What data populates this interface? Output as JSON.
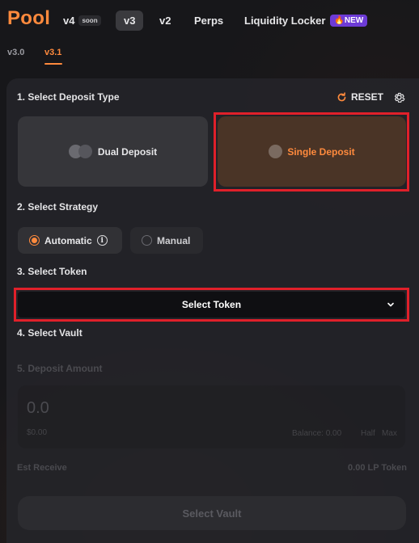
{
  "brand": {
    "logo": "Pool",
    "accent": "#ff8a3d"
  },
  "nav": {
    "tabs": [
      {
        "label": "v4",
        "badge": "soon"
      },
      {
        "label": "v3",
        "active": true
      },
      {
        "label": "v2"
      },
      {
        "label": "Perps"
      },
      {
        "label": "Liquidity Locker",
        "badge": "🔥NEW"
      }
    ],
    "subtabs": [
      {
        "label": "v3.0"
      },
      {
        "label": "v3.1",
        "active": true
      }
    ]
  },
  "form": {
    "step1": {
      "label": "1. Select Deposit Type",
      "reset_label": "RESET",
      "options": [
        {
          "label": "Dual Deposit"
        },
        {
          "label": "Single Deposit",
          "selected": true
        }
      ]
    },
    "step2": {
      "label": "2. Select Strategy",
      "options": [
        {
          "label": "Automatic",
          "selected": true
        },
        {
          "label": "Manual"
        }
      ]
    },
    "step3": {
      "label": "3. Select Token",
      "select_label": "Select Token"
    },
    "step4": {
      "label": "4. Select Vault"
    },
    "step5": {
      "label": "5. Deposit Amount",
      "amount": "0.0",
      "usd": "$0.00",
      "balance": "Balance: 0.00",
      "half_label": "Half",
      "max_label": "Max"
    },
    "est_receive": {
      "label": "Est Receive",
      "value": "0.00 LP Token"
    },
    "submit_label": "Select Vault"
  },
  "icons": {
    "reset": "refresh-icon",
    "settings": "gear-icon",
    "info": "info-icon",
    "chevron": "chevron-down-icon"
  },
  "colors": {
    "highlight": "#e0202a",
    "new_badge": "#6d3bd6"
  }
}
